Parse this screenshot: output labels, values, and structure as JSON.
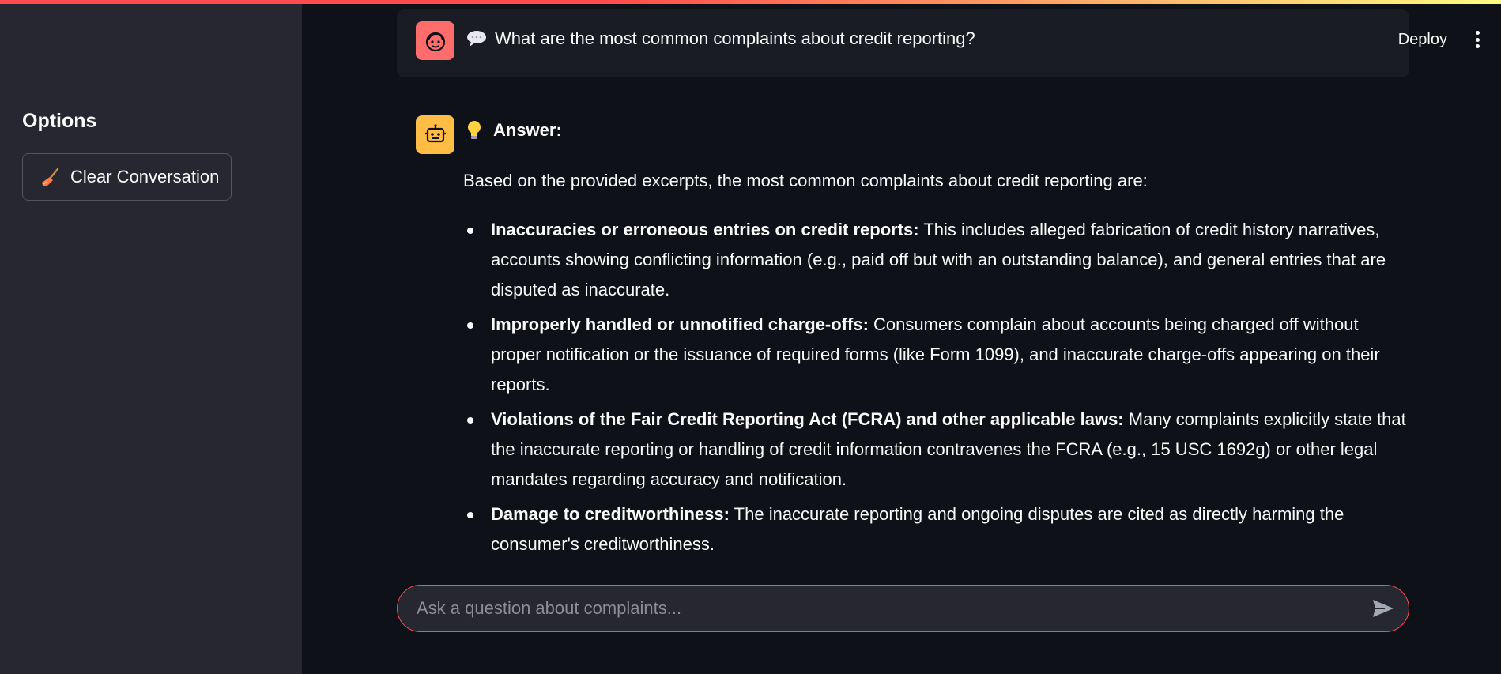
{
  "sidebar": {
    "title": "Options",
    "clear_button": {
      "label": "Clear Conversation",
      "icon": "broom-icon"
    }
  },
  "header": {
    "deploy_label": "Deploy",
    "menu_icon": "kebab-menu-icon"
  },
  "colors": {
    "accent": "#ff4b4b",
    "user_avatar": "#ff6c6c",
    "bot_avatar": "#ffbd45",
    "background": "#0e1117",
    "sidebar_bg": "#262730"
  },
  "messages": [
    {
      "role": "user",
      "icon": "speech-balloon-icon",
      "text": "What are the most common complaints about credit reporting?"
    },
    {
      "role": "assistant",
      "icon": "lightbulb-icon",
      "heading": "Answer:",
      "intro": "Based on the provided excerpts, the most common complaints about credit reporting are:",
      "bullets": [
        {
          "title": "Inaccuracies or erroneous entries on credit reports:",
          "text": " This includes alleged fabrication of credit history narratives, accounts showing conflicting information (e.g., paid off but with an outstanding balance), and general entries that are disputed as inaccurate."
        },
        {
          "title": "Improperly handled or unnotified charge-offs:",
          "text": " Consumers complain about accounts being charged off without proper notification or the issuance of required forms (like Form 1099), and inaccurate charge-offs appearing on their reports."
        },
        {
          "title": "Violations of the Fair Credit Reporting Act (FCRA) and other applicable laws:",
          "text": " Many complaints explicitly state that the inaccurate reporting or handling of credit information contravenes the FCRA (e.g., 15 USC 1692g) or other legal mandates regarding accuracy and notification."
        },
        {
          "title": "Damage to creditworthiness:",
          "text": " The inaccurate reporting and ongoing disputes are cited as directly harming the consumer's creditworthiness."
        }
      ]
    }
  ],
  "chat_input": {
    "placeholder": "Ask a question about complaints...",
    "value": "",
    "send_icon": "send-icon"
  }
}
